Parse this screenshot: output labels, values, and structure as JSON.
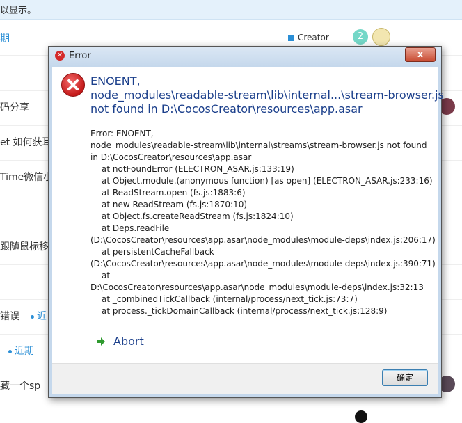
{
  "background": {
    "banner_text": "以显示。",
    "tag_label": "Creator",
    "badge_count": "2",
    "rows": [
      {
        "text": "期",
        "link": ""
      },
      {
        "text": "",
        "link": ""
      },
      {
        "text": "码分享",
        "link": ""
      },
      {
        "text": "et 如何获耳",
        "link": ""
      },
      {
        "text": "Time微信小",
        "link": ""
      },
      {
        "text": "",
        "link": ""
      },
      {
        "text": "跟随鼠标移",
        "link": ""
      },
      {
        "text": "",
        "link": ""
      },
      {
        "text": "错误",
        "link": "近"
      },
      {
        "text": "",
        "link": "近期"
      },
      {
        "text": "藏一个sp",
        "link": ""
      }
    ]
  },
  "dialog": {
    "title": "Error",
    "close_label": "x",
    "main_instruction": [
      "ENOENT,",
      "node_modules\\readable-stream\\lib\\internal...\\stream-browser.js",
      "not found in D:\\CocosCreator\\resources\\app.asar"
    ],
    "details": [
      {
        "text": "Error: ENOENT,",
        "indent": false
      },
      {
        "text": "node_modules\\readable-stream\\lib\\internal\\streams\\stream-browser.js not found",
        "indent": false
      },
      {
        "text": "in D:\\CocosCreator\\resources\\app.asar",
        "indent": false
      },
      {
        "text": "at notFoundError (ELECTRON_ASAR.js:133:19)",
        "indent": true
      },
      {
        "text": "at Object.module.(anonymous function) [as open] (ELECTRON_ASAR.js:233:16)",
        "indent": true
      },
      {
        "text": "at ReadStream.open (fs.js:1883:6)",
        "indent": true
      },
      {
        "text": "at new ReadStream (fs.js:1870:10)",
        "indent": true
      },
      {
        "text": "at Object.fs.createReadStream (fs.js:1824:10)",
        "indent": true
      },
      {
        "text": "at Deps.readFile",
        "indent": true
      },
      {
        "text": "(D:\\CocosCreator\\resources\\app.asar\\node_modules\\module-deps\\index.js:206:17)",
        "indent": false
      },
      {
        "text": "at persistentCacheFallback",
        "indent": true
      },
      {
        "text": "(D:\\CocosCreator\\resources\\app.asar\\node_modules\\module-deps\\index.js:390:71)",
        "indent": false
      },
      {
        "text": "at",
        "indent": true
      },
      {
        "text": "D:\\CocosCreator\\resources\\app.asar\\node_modules\\module-deps\\index.js:32:13",
        "indent": false
      },
      {
        "text": "at _combinedTickCallback (internal/process/next_tick.js:73:7)",
        "indent": true
      },
      {
        "text": "at process._tickDomainCallback (internal/process/next_tick.js:128:9)",
        "indent": true
      }
    ],
    "abort_label": "Abort",
    "ok_label": "确定",
    "colors": {
      "instruction": "#1b3f8b",
      "error": "#c41a1a"
    }
  }
}
